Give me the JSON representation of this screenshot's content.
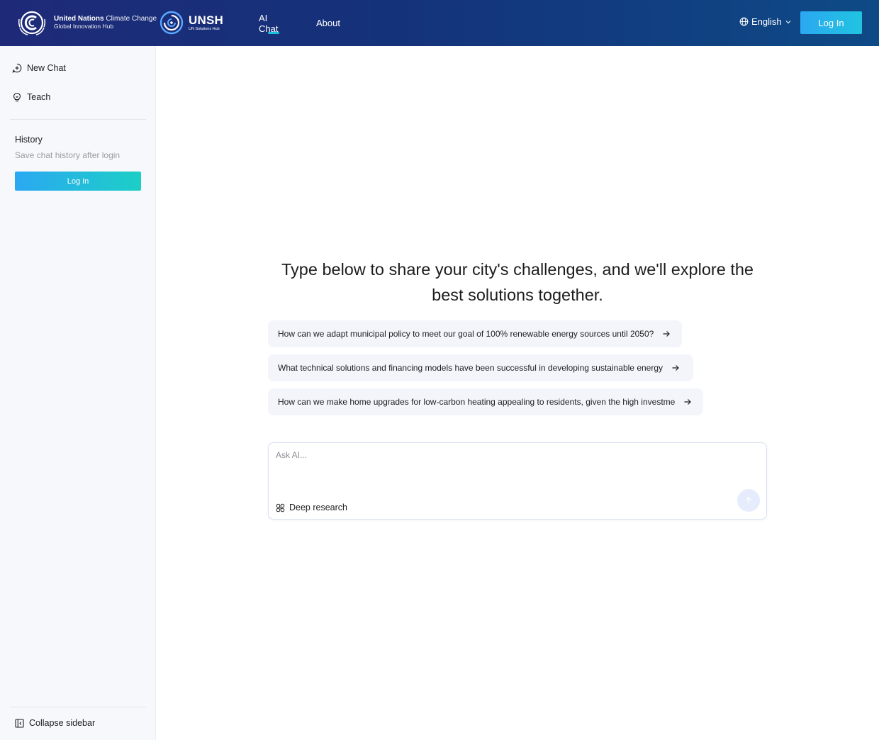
{
  "header": {
    "brand_unfccc_line1_bold": "United Nations",
    "brand_unfccc_line1_light": "Climate Change",
    "brand_unfccc_line2": "Global Innovation Hub",
    "brand_unsh_title": "UNSH",
    "brand_unsh_subtitle": "UN Solutions Hub",
    "nav": [
      {
        "label": "AI Chat",
        "active": true
      },
      {
        "label": "About",
        "active": false
      }
    ],
    "language": "English",
    "login_label": "Log In"
  },
  "sidebar": {
    "new_chat_label": "New Chat",
    "teach_label": "Teach",
    "history_title": "History",
    "history_hint": "Save chat history after login",
    "login_label": "Log In",
    "collapse_label": "Collapse sidebar"
  },
  "main": {
    "headline": "Type below to share your city's challenges, and we'll explore the best solutions together.",
    "suggestions": [
      "How can we adapt municipal policy to meet our goal of 100% renewable energy sources until 2050?",
      "What technical solutions and financing models have been successful in developing sustainable energy",
      "How can we make home upgrades for low-carbon heating appealing to residents, given the high investme"
    ],
    "input_placeholder": "Ask AI...",
    "deep_research_label": "Deep research"
  },
  "colors": {
    "header_start": "#1e2a78",
    "header_end": "#0e4a86",
    "accent": "#20c4e0",
    "sidebar_bg": "#f7f8fc"
  }
}
